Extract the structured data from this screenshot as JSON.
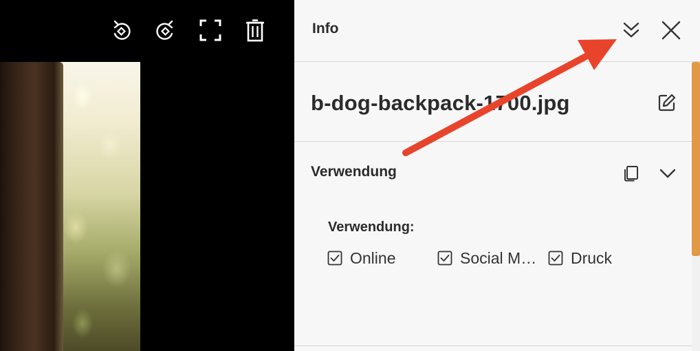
{
  "viewer": {
    "toolbar": {
      "rotate_left_icon": "rotate-left-icon",
      "rotate_right_icon": "rotate-right-icon",
      "fullscreen_icon": "fullscreen-icon",
      "delete_icon": "trash-icon"
    }
  },
  "panel": {
    "title": "Info",
    "collapse_icon": "double-chevron-down-icon",
    "close_icon": "close-icon",
    "filename": "b-dog-backpack-1700.jpg",
    "edit_icon": "edit-icon",
    "section": {
      "title": "Verwendung",
      "copy_icon": "copy-icon",
      "toggle_icon": "chevron-down-icon",
      "field_label": "Verwendung:",
      "options": [
        {
          "label": "Online",
          "checked": true
        },
        {
          "label": "Social M…",
          "checked": true
        },
        {
          "label": "Druck",
          "checked": true
        }
      ]
    }
  },
  "colors": {
    "accent_scrollbar": "#e09a46",
    "annotation_arrow": "#e8442c",
    "panel_background": "#f7f7f7",
    "viewer_background": "#000000"
  }
}
